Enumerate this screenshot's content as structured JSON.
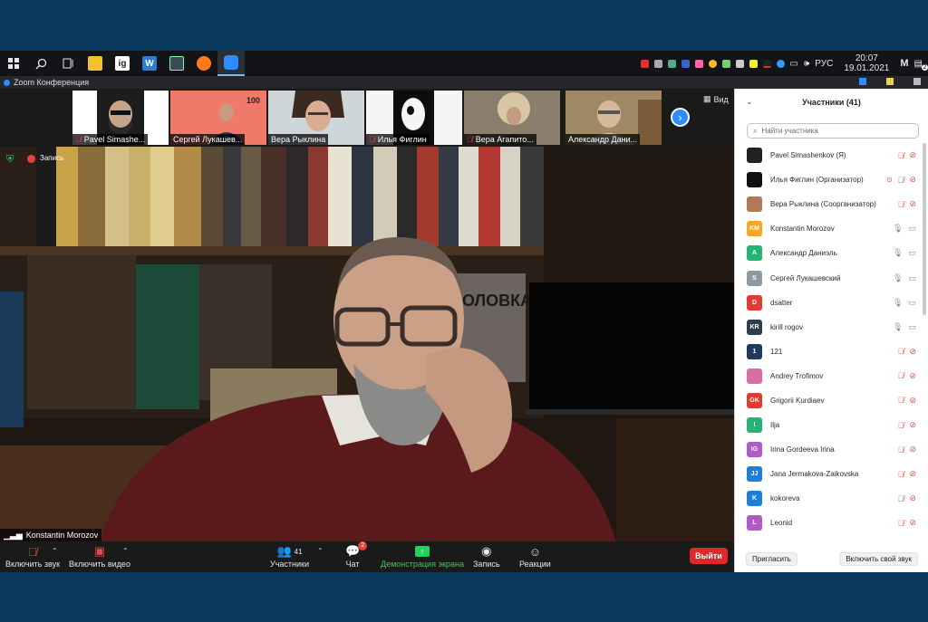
{
  "taskbar": {
    "apps": [
      {
        "name": "start-icon",
        "glyph": "⊞"
      },
      {
        "name": "search-icon",
        "glyph": "⌕"
      },
      {
        "name": "task-view-icon",
        "glyph": "⧉"
      },
      {
        "name": "file-explorer-icon",
        "glyph": ""
      },
      {
        "name": "ig-app-icon",
        "glyph": "ig"
      },
      {
        "name": "word-app-icon",
        "glyph": "W"
      },
      {
        "name": "terminal-app-icon",
        "glyph": ""
      },
      {
        "name": "firefox-icon",
        "glyph": ""
      },
      {
        "name": "zoom-app-icon",
        "glyph": ""
      }
    ],
    "lang": "РУС",
    "time": "20:07",
    "date": "19.01.2021",
    "notifications": "2"
  },
  "window": {
    "title": "Zoom Конференция"
  },
  "thumbnails": [
    {
      "name": "Pavel Simashe...",
      "muted": true,
      "bg": "#ffffff",
      "fg": "#1b1b1b"
    },
    {
      "name": "Сергей Лукашев...",
      "muted": false,
      "bg": "#f07a6a",
      "fg": "#2a3b4a"
    },
    {
      "name": "Вера Рыклина",
      "muted": false,
      "bg": "#cfd6d9",
      "fg": "#3b2a22"
    },
    {
      "name": "Илья Фиглин",
      "muted": true,
      "bg": "#f5f5f5",
      "fg": "#0d0d0d"
    },
    {
      "name": "Вера Агапито...",
      "muted": true,
      "bg": "#8a7e6c",
      "fg": "#d8c6a4"
    },
    {
      "name": "Александр Дани...",
      "muted": false,
      "bg": "#a08a65",
      "fg": "#d8d2c8"
    }
  ],
  "view_label": "Вид",
  "main": {
    "recording_label": "Запись",
    "speaker": "Konstantin Morozov"
  },
  "toolbar": {
    "audio": "Включить звук",
    "video": "Включить видео",
    "participants": "Участники",
    "participants_count": "41",
    "chat": "Чат",
    "chat_badge": "2",
    "share": "Демонстрация экрана",
    "record": "Запись",
    "reactions": "Реакции",
    "exit": "Выйти"
  },
  "panel": {
    "title": "Участники (41)",
    "search_placeholder": "Найти участника",
    "participants": [
      {
        "name": "Pavel Simashenkov (Я)",
        "initials": "",
        "color": "#222222",
        "photo": true,
        "mic": "off",
        "cam": "off",
        "rec": false
      },
      {
        "name": "Илья Фиглин (Организатор)",
        "initials": "",
        "color": "#111111",
        "photo": true,
        "mic": "off",
        "cam": "off",
        "rec": true
      },
      {
        "name": "Вера Рыклина (Соорганизатор)",
        "initials": "",
        "color": "#b07a5a",
        "photo": true,
        "mic": "off",
        "cam": "off",
        "rec": false
      },
      {
        "name": "Konstantin Morozov",
        "initials": "KM",
        "color": "#f5a623",
        "photo": false,
        "mic": "on",
        "cam": "on",
        "rec": false
      },
      {
        "name": "Александр Даниэль",
        "initials": "А",
        "color": "#22b573",
        "photo": false,
        "mic": "on",
        "cam": "on",
        "rec": false
      },
      {
        "name": "Сергей Лукашевский",
        "initials": "S",
        "color": "#8a9aa6",
        "photo": false,
        "mic": "on",
        "cam": "on",
        "rec": false
      },
      {
        "name": "dsatter",
        "initials": "D",
        "color": "#e03c31",
        "photo": false,
        "mic": "on",
        "cam": "on",
        "rec": false
      },
      {
        "name": "kirill rogov",
        "initials": "KR",
        "color": "#2c3e50",
        "photo": false,
        "mic": "on",
        "cam": "on",
        "rec": false
      },
      {
        "name": "121",
        "initials": "1",
        "color": "#1f3a5a",
        "photo": false,
        "mic": "off",
        "cam": "off",
        "rec": false
      },
      {
        "name": "Andrey Trofimov",
        "initials": "",
        "color": "#d96fa0",
        "photo": true,
        "mic": "off",
        "cam": "off",
        "rec": false
      },
      {
        "name": "Grigorii Kurdiaev",
        "initials": "GK",
        "color": "#e03c31",
        "photo": false,
        "mic": "off",
        "cam": "off",
        "rec": false
      },
      {
        "name": "Ilja",
        "initials": "I",
        "color": "#22b573",
        "photo": false,
        "mic": "off",
        "cam": "off",
        "rec": false
      },
      {
        "name": "Irina Gordeeva Irina",
        "initials": "IG",
        "color": "#b05cc6",
        "photo": false,
        "mic": "off",
        "cam": "off",
        "rec": false
      },
      {
        "name": "Jana Jermakova-Zaikovska",
        "initials": "JJ",
        "color": "#1e7fd6",
        "photo": false,
        "mic": "off",
        "cam": "off",
        "rec": false
      },
      {
        "name": "kokoreva",
        "initials": "K",
        "color": "#1e7fd6",
        "photo": false,
        "mic": "off",
        "cam": "off",
        "rec": false
      },
      {
        "name": "Leonid",
        "initials": "L",
        "color": "#b05cc6",
        "photo": false,
        "mic": "off",
        "cam": "off",
        "rec": false
      }
    ],
    "invite_label": "Пригласить",
    "unmute_self_label": "Включить свой звук"
  }
}
